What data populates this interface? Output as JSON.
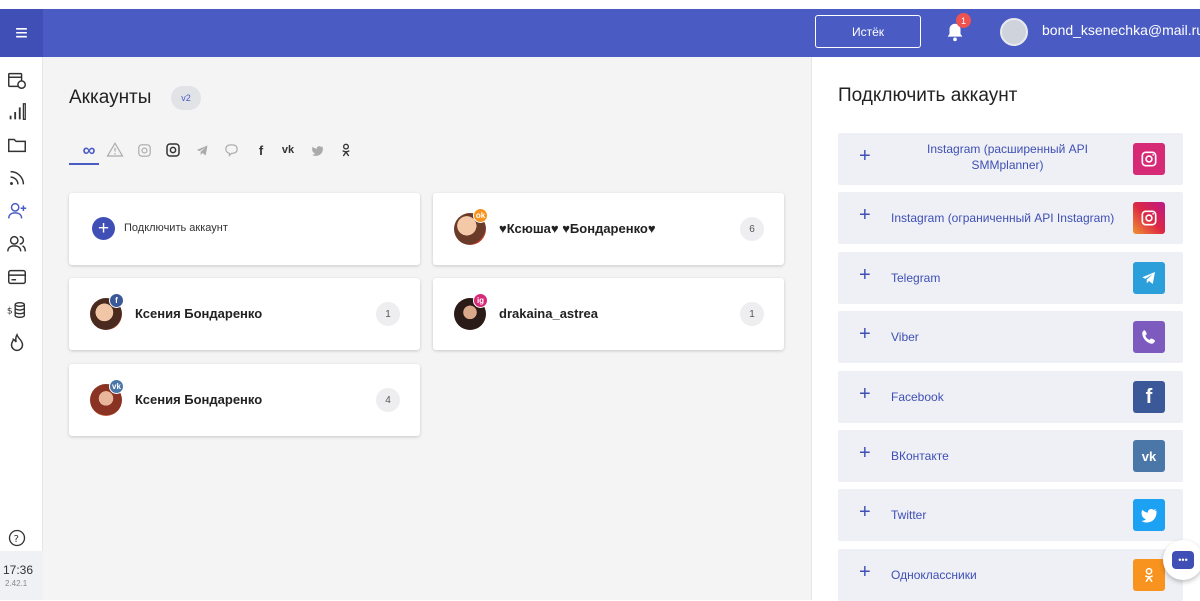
{
  "header": {
    "menu_icon": "≡",
    "status_button": "Истёк",
    "notifications_count": "1",
    "user_email": "bond_ksenechka@mail.ru"
  },
  "sidebar": {
    "icons": [
      "calendar-clock-icon",
      "stats-icon",
      "folder-icon",
      "rss-icon",
      "add-user-icon",
      "users-icon",
      "card-icon",
      "billing-icon",
      "fire-icon"
    ],
    "help_icon": "?",
    "time": "17:36",
    "version": "2.42.1"
  },
  "main": {
    "title": "Аккаунты",
    "version_badge": "v2",
    "filters": [
      "all",
      "warning",
      "instagram",
      "instagram-api",
      "telegram",
      "viber",
      "facebook",
      "vk",
      "twitter",
      "odnoklassniki"
    ],
    "connect_label": "Подключить аккаунт",
    "accounts": [
      {
        "name": "♥Ксюша♥ ♥Бондаренко♥",
        "count": "6",
        "network": "ok",
        "badge": "ok",
        "badge_color": "#f7931e"
      },
      {
        "name": "Ксения Бондаренко",
        "count": "1",
        "network": "facebook",
        "badge": "f",
        "badge_color": "#3b5998"
      },
      {
        "name": "drakaina_astrea",
        "count": "1",
        "network": "instagram",
        "badge": "ig",
        "badge_color": "#d62976"
      },
      {
        "name": "Ксения Бондаренко",
        "count": "4",
        "network": "vk",
        "badge": "vk",
        "badge_color": "#4a76a8"
      }
    ]
  },
  "right_panel": {
    "title": "Подключить аккаунт",
    "networks": [
      {
        "label": "Instagram (расширенный API SMMplanner)",
        "icon": "instagram-icon",
        "color": "#d62976"
      },
      {
        "label": "Instagram (ограниченный API Instagram)",
        "icon": "instagram-icon",
        "color": "#e1306c"
      },
      {
        "label": "Telegram",
        "icon": "telegram-icon",
        "color": "#2b9fd9"
      },
      {
        "label": "Viber",
        "icon": "viber-icon",
        "color": "#7d5bbe"
      },
      {
        "label": "Facebook",
        "icon": "facebook-icon",
        "color": "#3b5998"
      },
      {
        "label": "ВКонтакте",
        "icon": "vk-icon",
        "color": "#4a76a8"
      },
      {
        "label": "Twitter",
        "icon": "twitter-icon",
        "color": "#1da1f2"
      },
      {
        "label": "Одноклассники",
        "icon": "odnoklassniki-icon",
        "color": "#f7931e"
      }
    ]
  },
  "colors": {
    "header": "#4a5bc3",
    "accent": "#3f4fb5",
    "background": "#f4f4f5"
  }
}
